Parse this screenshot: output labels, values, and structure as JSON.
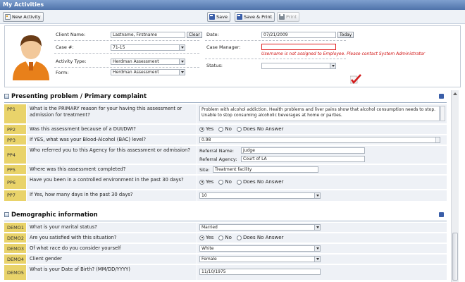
{
  "window": {
    "title": "My Activities"
  },
  "toolbar": {
    "new_activity": "New Activity",
    "save": "Save",
    "save_print": "Save & Print",
    "print": "Print"
  },
  "header": {
    "client_name_label": "Client Name:",
    "client_name_value": "Lastname, Firstname",
    "clear_label": "Clear",
    "case_label": "Case #:",
    "case_value": "71-15",
    "activity_type_label": "Activity Type:",
    "activity_type_value": "Herdman Assessment",
    "form_label": "Form:",
    "form_value": "Herdman Assessment",
    "date_label": "Date:",
    "date_value": "07/21/2009",
    "today_label": "Today",
    "case_manager_label": "Case Manager:",
    "case_manager_error": "Username is not assigned to Employee. Please contact System Administrator",
    "status_label": "Status:",
    "status_value": ""
  },
  "sections": {
    "presenting": {
      "title": "Presenting problem / Primary complaint",
      "rows": [
        {
          "code": "PP1",
          "question": "What is the PRIMARY reason for your having this assessment or admission for treatment?",
          "answer": "Problem with alcohol addiction. Health problems and liver pains show that alcohol consumption needs to stop. Unable to stop consuming alcoholic beverages at home or parties."
        },
        {
          "code": "PP2",
          "question": "Was this assessment because of a DUI/DWI?"
        },
        {
          "code": "PP3",
          "question": "If YES, what was your Blood-Alcohol (BAC) level?",
          "answer": "0.98"
        },
        {
          "code": "PP4",
          "question": "Who referred you to this Agency for this assessment or admission?",
          "referral_name_label": "Referral Name:",
          "referral_name_value": "Judge",
          "referral_agency_label": "Referral Agency:",
          "referral_agency_value": "Court of LA"
        },
        {
          "code": "PP5",
          "question": "Where was this assessment completed?",
          "site_label": "Site:",
          "site_value": "Treatment facility"
        },
        {
          "code": "PP6",
          "question": "Have you been in a controlled environment in the past 30 days?"
        },
        {
          "code": "PP7",
          "question": "If Yes, how many days in the past 30 days?",
          "answer": "10"
        }
      ]
    },
    "demographic": {
      "title": "Demographic information",
      "rows": [
        {
          "code": "DEMO1",
          "question": "What is your marital status?",
          "answer": "Married"
        },
        {
          "code": "DEMO2",
          "question": "Are you satisfied with this situation?"
        },
        {
          "code": "DEMO3",
          "question": "Of what race do you consider yourself",
          "answer": "White"
        },
        {
          "code": "DEMO4",
          "question": "Client gender",
          "answer": "Female"
        },
        {
          "code": "DEMO5",
          "question": "What is your Date of Birth? (MM/DD/YYYY)",
          "answer": "11/10/1975"
        }
      ]
    }
  },
  "radio_options": {
    "yes": "Yes",
    "no": "No",
    "none": "Does No Answer"
  }
}
